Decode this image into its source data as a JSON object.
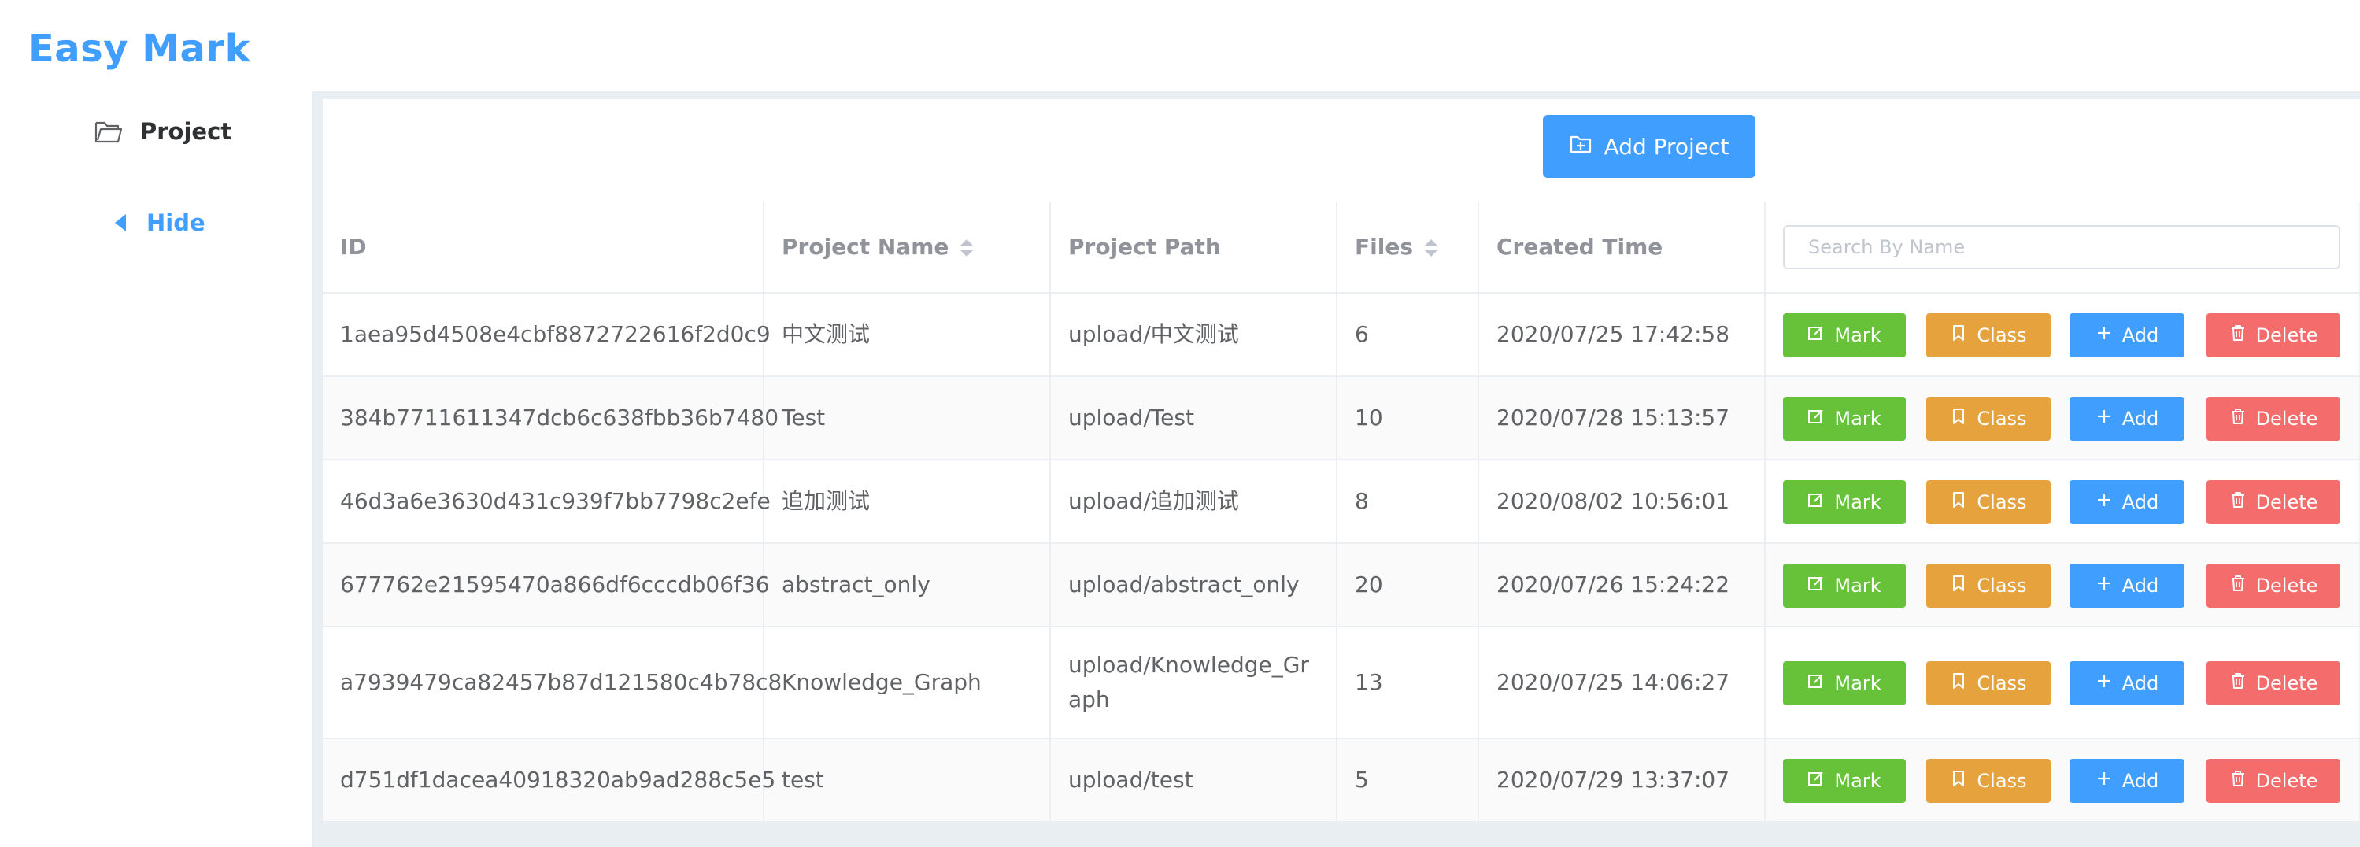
{
  "app": {
    "title": "Easy Mark"
  },
  "sidebar": {
    "project_label": "Project",
    "hide_label": "Hide"
  },
  "toolbar": {
    "add_project_label": "Add Project"
  },
  "table": {
    "columns": {
      "id": "ID",
      "name": "Project Name",
      "path": "Project Path",
      "files": "Files",
      "created": "Created Time"
    },
    "search_placeholder": "Search By Name",
    "actions": {
      "mark": "Mark",
      "class": "Class",
      "add": "Add",
      "delete": "Delete"
    },
    "rows": [
      {
        "id": "1aea95d4508e4cbf8872722616f2d0c9",
        "name": "中文测试",
        "path": "upload/中文测试",
        "files": "6",
        "created": "2020/07/25 17:42:58"
      },
      {
        "id": "384b7711611347dcb6c638fbb36b7480",
        "name": "Test",
        "path": "upload/Test",
        "files": "10",
        "created": "2020/07/28 15:13:57"
      },
      {
        "id": "46d3a6e3630d431c939f7bb7798c2efe",
        "name": "追加测试",
        "path": "upload/追加测试",
        "files": "8",
        "created": "2020/08/02 10:56:01"
      },
      {
        "id": "677762e21595470a866df6cccdb06f36",
        "name": "abstract_only",
        "path": "upload/abstract_only",
        "files": "20",
        "created": "2020/07/26 15:24:22"
      },
      {
        "id": "a7939479ca82457b87d121580c4b78c8",
        "name": "Knowledge_Graph",
        "path": "upload/Knowledge_Graph",
        "files": "13",
        "created": "2020/07/25 14:06:27"
      },
      {
        "id": "d751df1dacea40918320ab9ad288c5e5",
        "name": "test",
        "path": "upload/test",
        "files": "5",
        "created": "2020/07/29 13:37:07"
      }
    ]
  },
  "colors": {
    "primary": "#409eff",
    "success": "#67c23a",
    "warning": "#e6a23c",
    "danger": "#f56c6c",
    "background": "#e9eef3"
  },
  "icons": {
    "project": "folder-open-icon",
    "hide": "caret-left-icon",
    "add_project": "folder-add-icon",
    "mark": "edit-icon",
    "class": "bookmark-icon",
    "add": "plus-icon",
    "delete": "trash-icon",
    "sort": "sort-caret-icon"
  }
}
